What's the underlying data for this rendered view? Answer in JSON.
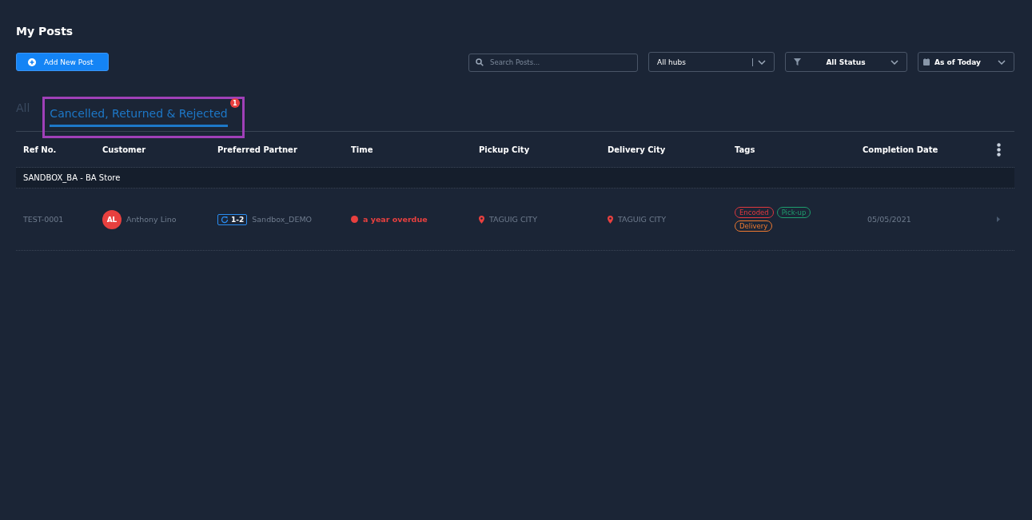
{
  "page_title": "My Posts",
  "add_button": "Add New Post",
  "search": {
    "placeholder": "Search Posts..."
  },
  "filters": [
    {
      "kind": "hubs",
      "label": "All hubs"
    },
    {
      "kind": "status",
      "label": "All Status"
    },
    {
      "kind": "date",
      "label": "As of Today"
    }
  ],
  "tabs": [
    {
      "label": "All",
      "selected": false,
      "highlighted": false
    },
    {
      "label": "Cancelled, Returned & Rejected",
      "selected": true,
      "highlighted": true,
      "badge": "1"
    }
  ],
  "table": {
    "columns": [
      "Ref No.",
      "Customer",
      "Preferred Partner",
      "Time",
      "Pickup City",
      "Delivery City",
      "Tags",
      "Completion Date"
    ],
    "groups": [
      {
        "name": "SANDBOX_BA - BA Store",
        "rows": [
          {
            "ref": "TEST-0001",
            "customer_initials": "AL",
            "customer": "Anthony Lino",
            "partner_code": "1-2",
            "partner": "Sandbox_DEMO",
            "time": "a year overdue",
            "pickup_city": "TAGUIG CITY",
            "delivery_city": "TAGUIG CITY",
            "tags": [
              {
                "label": "Encoded",
                "color": "#e0383e"
              },
              {
                "label": "Pick-up",
                "color": "#1e9e6e"
              },
              {
                "label": "Delivery",
                "color": "#f07a30"
              }
            ],
            "completion_date": "05/05/2021"
          }
        ]
      }
    ]
  }
}
